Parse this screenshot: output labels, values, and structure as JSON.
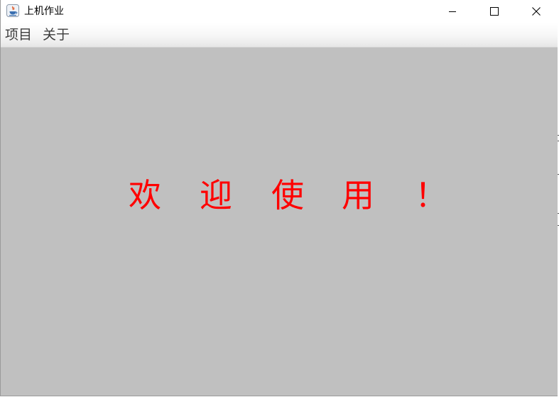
{
  "window": {
    "title": "上机作业",
    "controls": {
      "minimize": "minimize",
      "maximize": "maximize",
      "close": "close"
    }
  },
  "menubar": {
    "items": [
      {
        "label": "项目"
      },
      {
        "label": "关于"
      }
    ]
  },
  "content": {
    "background": "#c0c0c0",
    "welcome_color": "#ff0000",
    "welcome_chars": [
      "欢",
      "迎",
      "使",
      "用",
      "！"
    ]
  }
}
